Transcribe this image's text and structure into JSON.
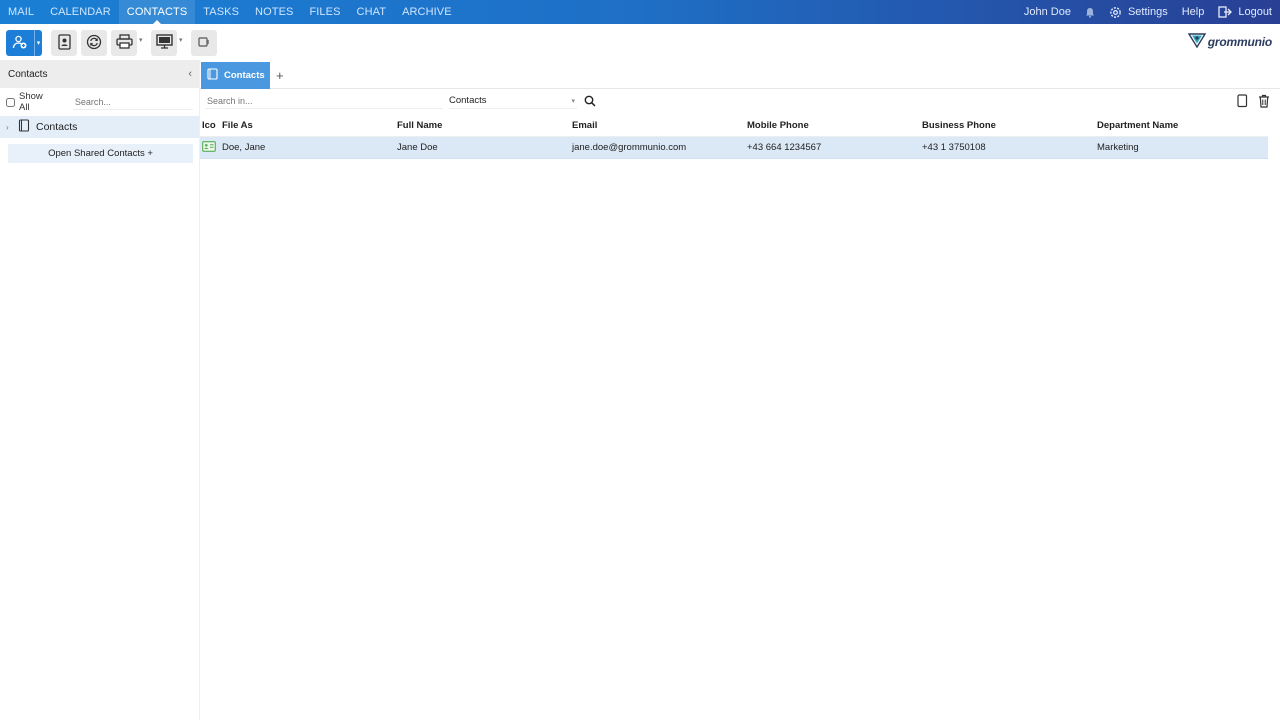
{
  "nav": {
    "items": [
      {
        "label": "MAIL"
      },
      {
        "label": "CALENDAR"
      },
      {
        "label": "CONTACTS",
        "active": true
      },
      {
        "label": "TASKS"
      },
      {
        "label": "NOTES"
      },
      {
        "label": "FILES"
      },
      {
        "label": "CHAT"
      },
      {
        "label": "ARCHIVE"
      }
    ],
    "user": "John Doe",
    "settings": "Settings",
    "help": "Help",
    "logout": "Logout"
  },
  "logo": {
    "text": "grommunio"
  },
  "sidebar": {
    "title": "Contacts",
    "show_all": "Show All",
    "search_placeholder": "Search...",
    "tree_item": "Contacts",
    "shared_button": "Open Shared Contacts +"
  },
  "tabs": {
    "active_label": "Contacts",
    "add_label": "+"
  },
  "search": {
    "placeholder": "Search in...",
    "scope": "Contacts"
  },
  "grid": {
    "columns": [
      "Ico",
      "File As",
      "Full Name",
      "Email",
      "Mobile Phone",
      "Business Phone",
      "Department Name"
    ],
    "rows": [
      {
        "file_as": "Doe, Jane",
        "full_name": "Jane Doe",
        "email": "jane.doe@grommunio.com",
        "mobile": "+43 664 1234567",
        "business": "+43 1 3750108",
        "department": "Marketing",
        "selected": true
      }
    ]
  },
  "colors": {
    "nav_start": "#1a7fd4",
    "nav_end": "#283f94",
    "accent": "#1c7ed6",
    "tab_active": "#4a98e0",
    "row_selected": "#dbe8f6"
  }
}
